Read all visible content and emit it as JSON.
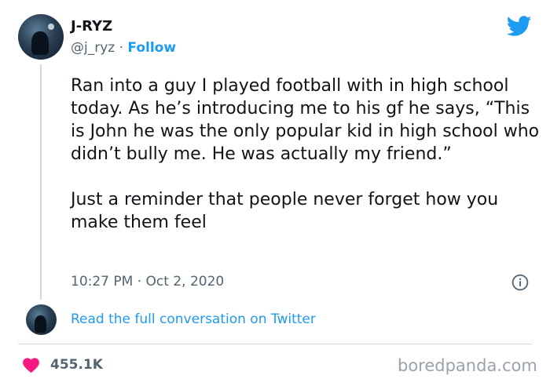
{
  "author": {
    "display_name": "J-RYZ",
    "handle": "@j_ryz",
    "separator": " · ",
    "follow_label": "Follow"
  },
  "tweet": {
    "paragraph_1": "Ran into a guy I played football with in high school today. As he’s introducing me to his gf he says, “This is John he was the only popular kid in high school who didn’t bully me. He was actually my friend.”",
    "paragraph_2": "Just a reminder that people never forget how you make them feel",
    "timestamp": "10:27 PM · Oct 2, 2020"
  },
  "conversation": {
    "link_text": "Read the full conversation on Twitter"
  },
  "engagement": {
    "likes": "455.1K"
  },
  "watermark": "boredpanda.com",
  "icons": {
    "brand": "twitter-bird-icon",
    "info": "info-icon",
    "like": "heart-icon"
  },
  "colors": {
    "accent": "#1d9bf0",
    "like": "#f91880",
    "text": "#0f1419",
    "muted": "#536471"
  }
}
